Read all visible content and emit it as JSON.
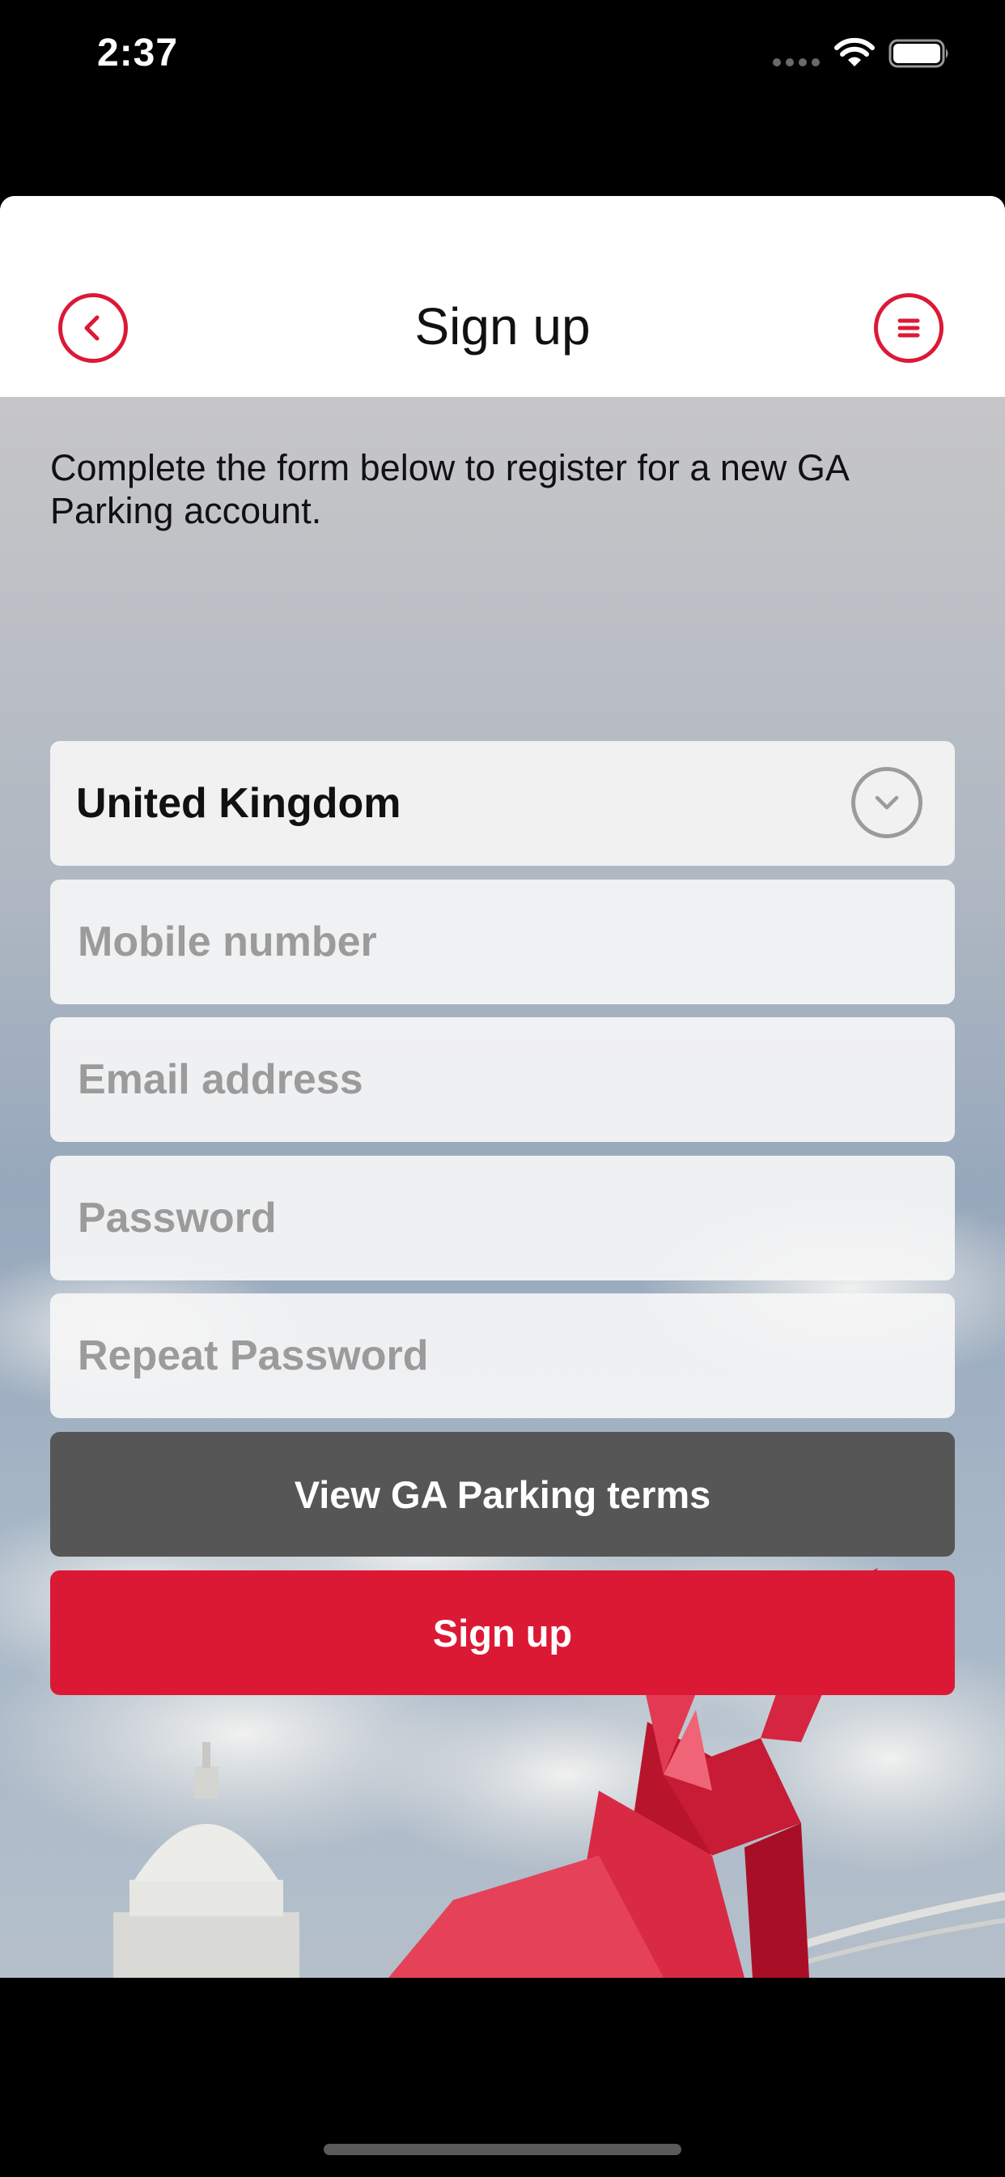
{
  "status_bar": {
    "time": "2:37",
    "icons": [
      "signal-icon",
      "wifi-icon",
      "battery-icon"
    ]
  },
  "nav": {
    "title": "Sign up",
    "back_icon": "chevron-left-circle-icon",
    "menu_icon": "menu-circle-icon"
  },
  "form": {
    "intro": "Complete the form below to register for a new GA Parking account.",
    "country": {
      "value": "United Kingdom",
      "icon": "chevron-down-circle-icon"
    },
    "mobile_placeholder": "Mobile number",
    "email_placeholder": "Email address",
    "password_placeholder": "Password",
    "repeat_password_placeholder": "Repeat Password",
    "terms_button": "View GA Parking terms",
    "signup_button": "Sign up"
  },
  "colors": {
    "accent": "#dc1935",
    "secondary_button": "#565656",
    "placeholder": "#9b9b9b"
  }
}
